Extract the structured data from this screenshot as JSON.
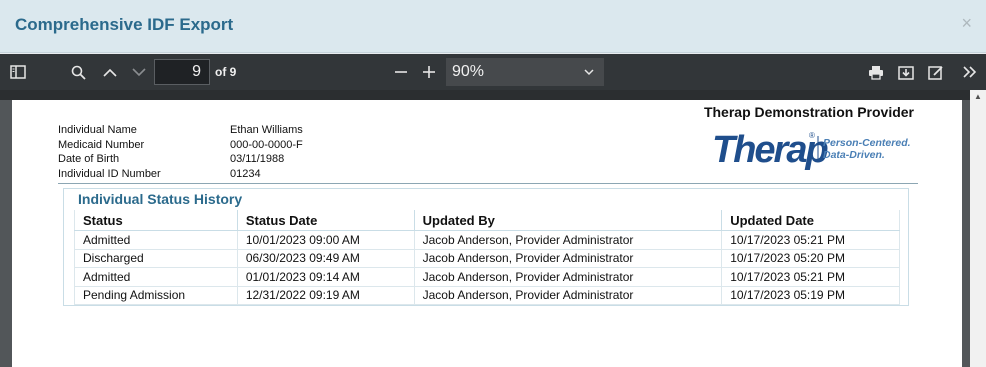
{
  "dialog": {
    "title": "Comprehensive IDF Export",
    "close_glyph": "×"
  },
  "toolbar": {
    "page_number": "9",
    "page_of": "of 9",
    "zoom": "90%"
  },
  "document": {
    "provider": "Therap Demonstration Provider",
    "logo": {
      "wordmark": "Therap",
      "tagline_1": "Person-Centered.",
      "tagline_2": "Data-Driven."
    },
    "info": [
      {
        "label": "Individual Name",
        "value": "Ethan Williams"
      },
      {
        "label": "Medicaid Number",
        "value": "000-00-0000-F"
      },
      {
        "label": "Date of Birth",
        "value": "03/11/1988"
      },
      {
        "label": "Individual ID Number",
        "value": "01234"
      }
    ],
    "section_title": "Individual Status History",
    "table": {
      "headers": [
        "Status",
        "Status Date",
        "Updated By",
        "Updated Date"
      ],
      "rows": [
        [
          "Admitted",
          "10/01/2023 09:00 AM",
          "Jacob Anderson, Provider Administrator",
          "10/17/2023 05:21 PM"
        ],
        [
          "Discharged",
          "06/30/2023 09:49 AM",
          "Jacob Anderson, Provider Administrator",
          "10/17/2023 05:20 PM"
        ],
        [
          "Admitted",
          "01/01/2023 09:14 AM",
          "Jacob Anderson, Provider Administrator",
          "10/17/2023 05:21 PM"
        ],
        [
          "Pending Admission",
          "12/31/2022 09:19 AM",
          "Jacob Anderson, Provider Administrator",
          "10/17/2023 05:19 PM"
        ]
      ]
    }
  },
  "colors": {
    "title": "#2b6a8c",
    "toolbar": "#323639",
    "logo_blue": "#1f4e8c"
  },
  "icons": [
    "sidebar-toggle-icon",
    "search-icon",
    "chevron-up-icon",
    "chevron-down-icon",
    "zoom-out-icon",
    "zoom-in-icon",
    "print-icon",
    "download-icon",
    "annotate-icon",
    "more-tools-icon"
  ]
}
